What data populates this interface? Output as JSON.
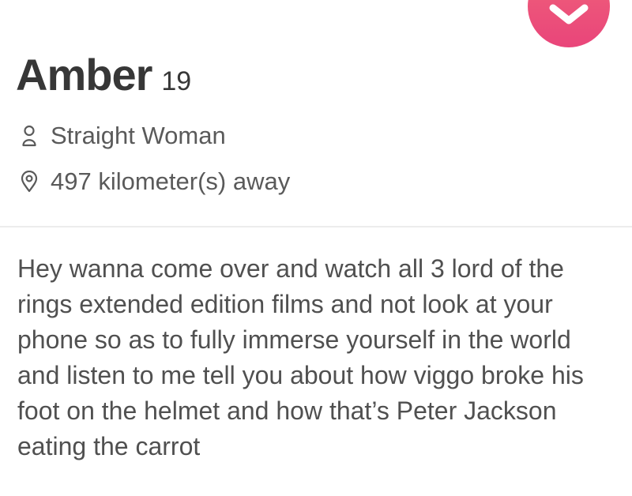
{
  "profile": {
    "name": "Amber",
    "age": "19",
    "orientation": "Straight Woman",
    "distance": "497 kilometer(s) away",
    "bio": "Hey wanna come over and watch all 3 lord of the rings extended edition films and not look at your phone so as to fully immerse yourself in the world and listen to me tell you about how viggo broke his foot on the helmet and how that’s Peter Jackson eating the carrot"
  },
  "icons": {
    "like": "heart-chevron-icon",
    "orientation": "person-icon",
    "distance": "location-pin-icon"
  },
  "colors": {
    "like_button": "#ec4f7a",
    "text_primary": "#373737",
    "text_secondary": "#5a5a5a",
    "divider": "#ececec"
  }
}
